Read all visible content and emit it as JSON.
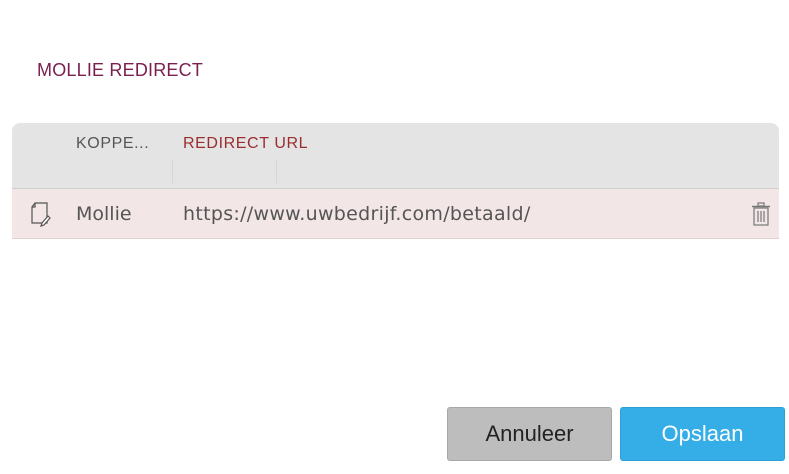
{
  "section": {
    "title": "MOLLIE REDIRECT"
  },
  "table": {
    "columns": [
      "KOPPE...",
      "REDIRECT URL"
    ],
    "rows": [
      {
        "icon": "document-edit-icon",
        "name": "Mollie",
        "url": "https://www.uwbedrijf.com/betaald/",
        "action_icon": "trash-icon"
      }
    ]
  },
  "footer": {
    "cancel_label": "Annuleer",
    "save_label": "Opslaan"
  },
  "colors": {
    "title": "#7a1d4f",
    "header_url": "#9a2d2d",
    "row_bg": "#f3e6e6",
    "header_bg": "#e4e4e4",
    "save_button": "#35aee8",
    "cancel_button": "#bdbdbd"
  }
}
